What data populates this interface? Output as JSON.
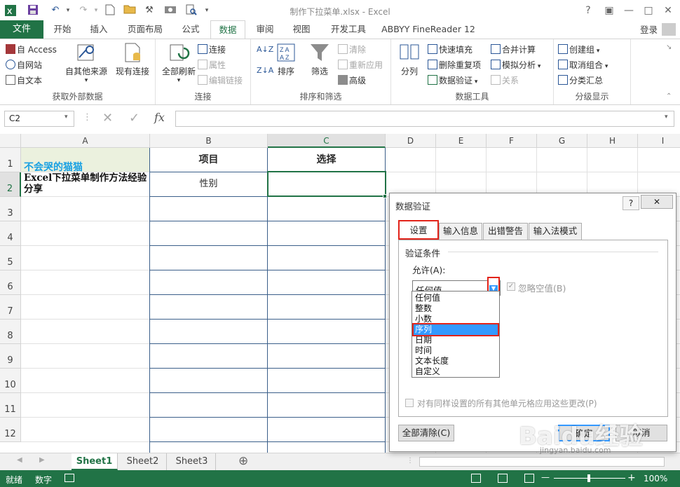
{
  "window": {
    "title": "制作下拉菜单.xlsx - Excel",
    "help": "?",
    "minimize": "—",
    "restore": "□",
    "close": "✕"
  },
  "ribbon_tabs": {
    "file": "文件",
    "tabs": [
      "开始",
      "插入",
      "页面布局",
      "公式",
      "数据",
      "审阅",
      "视图",
      "开发工具",
      "ABBYY FineReader 12"
    ],
    "active": "数据",
    "login": "登录"
  },
  "ribbon": {
    "get_external": {
      "from_access": "自 Access",
      "from_web": "自网站",
      "from_text": "自文本",
      "from_other": "自其他来源",
      "existing": "现有连接",
      "label": "获取外部数据"
    },
    "connections": {
      "refresh_all": "全部刷新",
      "connections": "连接",
      "properties": "属性",
      "edit_links": "编辑链接",
      "label": "连接"
    },
    "sort_filter": {
      "sort": "排序",
      "filter": "筛选",
      "clear": "清除",
      "reapply": "重新应用",
      "advanced": "高级",
      "label": "排序和筛选"
    },
    "data_tools": {
      "split": "分列",
      "flash_fill": "快速填充",
      "remove_dup": "删除重复项",
      "validation": "数据验证",
      "consolidate": "合并计算",
      "whatif": "模拟分析",
      "relations": "关系",
      "label": "数据工具"
    },
    "outline": {
      "group": "创建组",
      "ungroup": "取消组合",
      "subtotal": "分类汇总",
      "label": "分级显示"
    }
  },
  "formula_bar": {
    "name_box": "C2",
    "fx": "fx",
    "value": ""
  },
  "sheet": {
    "columns": [
      "A",
      "B",
      "C",
      "D",
      "E",
      "F",
      "G",
      "H",
      "I"
    ],
    "rows": [
      "1",
      "2",
      "3",
      "4",
      "5",
      "6",
      "7",
      "8",
      "9",
      "10",
      "11",
      "12"
    ],
    "selected_column": "C",
    "selected_row": "2",
    "cells": {
      "A1": "不会哭的猫猫",
      "A2": "Excel下拉菜单制作方法经验分享",
      "B1": "项目",
      "C1": "选择",
      "B2": "性别"
    },
    "colors": {
      "a1_text": "#1ba1e2",
      "a1_fill": "#ebf1de"
    }
  },
  "sheet_tabs": {
    "tabs": [
      "Sheet1",
      "Sheet2",
      "Sheet3"
    ],
    "active": "Sheet1",
    "add": "⊕"
  },
  "status_bar": {
    "ready": "就绪",
    "mode": "数字",
    "zoom": "100%",
    "minus": "—",
    "plus": "+"
  },
  "dialog": {
    "title": "数据验证",
    "help": "?",
    "close": "✕",
    "tabs": [
      "设置",
      "输入信息",
      "出错警告",
      "输入法模式"
    ],
    "active_tab": "设置",
    "section": "验证条件",
    "allow_label": "允许(A):",
    "allow_value": "任何值",
    "ignore_blank": "忽略空值(B)",
    "options": [
      "任何值",
      "整数",
      "小数",
      "序列",
      "日期",
      "时间",
      "文本长度",
      "自定义"
    ],
    "highlighted_option": "序列",
    "apply_all": "对有同样设置的所有其他单元格应用这些更改(P)",
    "clear_all": "全部清除(C)",
    "ok": "确定",
    "cancel": "取消"
  },
  "watermark": {
    "brand": "Baidu经验",
    "url": "jingyan.baidu.com"
  },
  "colors": {
    "excel_green": "#217346",
    "highlight_red": "#e2231a",
    "selection_blue": "#3399ff"
  }
}
